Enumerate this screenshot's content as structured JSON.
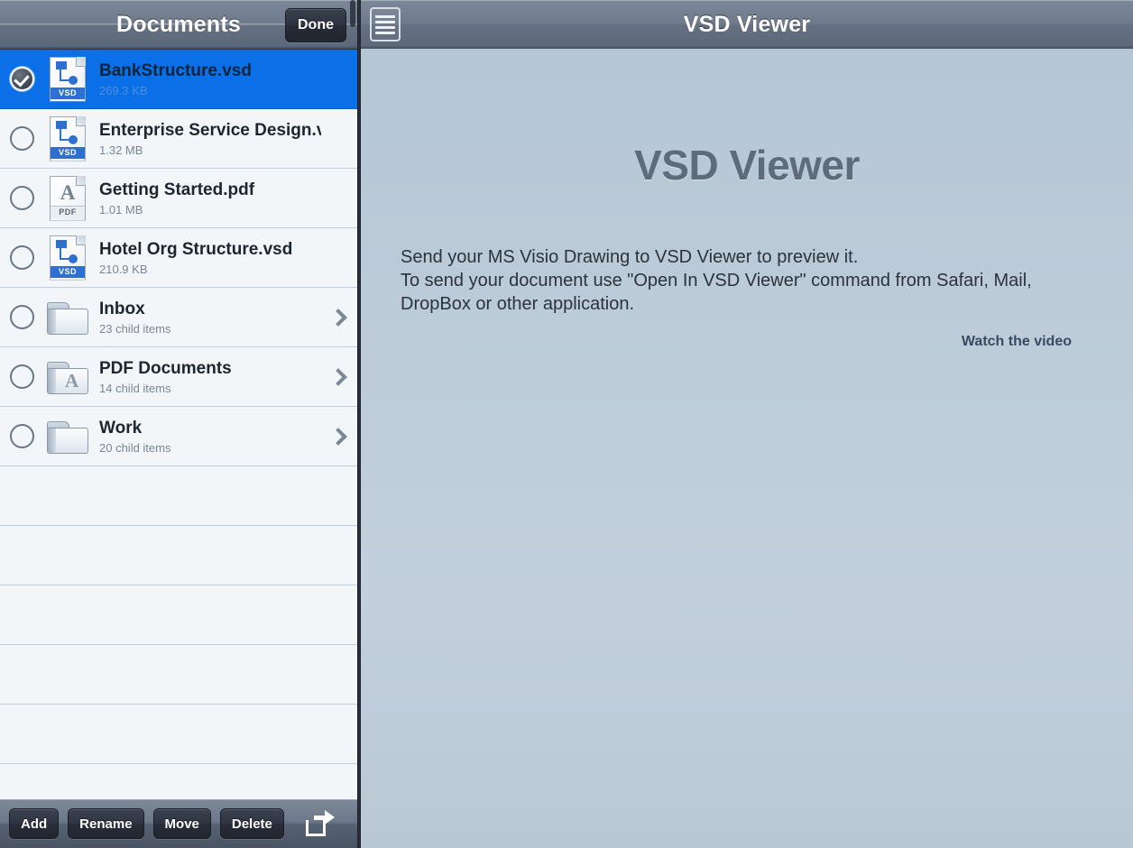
{
  "left_panel": {
    "navbar": {
      "title": "Documents",
      "done_label": "Done"
    },
    "files": [
      {
        "name": "BankStructure.vsd",
        "detail": "269.3 KB",
        "kind": "vsd",
        "selected": true,
        "badge": "VSD",
        "has_chevron": false
      },
      {
        "name": "Enterprise Service Design.vs",
        "detail": "1.32 MB",
        "kind": "vsd",
        "selected": false,
        "badge": "VSD",
        "has_chevron": false
      },
      {
        "name": "Getting Started.pdf",
        "detail": "1.01 MB",
        "kind": "pdf",
        "selected": false,
        "badge": "PDF",
        "has_chevron": false
      },
      {
        "name": "Hotel Org Structure.vsd",
        "detail": "210.9 KB",
        "kind": "vsd",
        "selected": false,
        "badge": "VSD",
        "has_chevron": false
      },
      {
        "name": "Inbox",
        "detail": "23 child items",
        "kind": "folder",
        "selected": false,
        "badge": "",
        "has_chevron": true
      },
      {
        "name": "PDF Documents",
        "detail": "14 child items",
        "kind": "folder-pdf",
        "selected": false,
        "badge": "",
        "has_chevron": true
      },
      {
        "name": "Work",
        "detail": "20 child items",
        "kind": "folder",
        "selected": false,
        "badge": "",
        "has_chevron": true
      }
    ],
    "empty_row_count": 6,
    "toolbar": {
      "add_label": "Add",
      "rename_label": "Rename",
      "move_label": "Move",
      "delete_label": "Delete",
      "share_icon": "share-icon"
    }
  },
  "right_panel": {
    "navbar": {
      "title": "VSD Viewer",
      "menu_icon": "list-menu-icon"
    },
    "heading": "VSD Viewer",
    "instructions": {
      "line1": "Send your MS Visio Drawing to VSD Viewer to preview it.",
      "line2": "To send your document use \"Open In VSD Viewer\" command from Safari, Mail,",
      "line3": "DropBox or other application."
    },
    "watch_video_label": "Watch the video"
  },
  "colors": {
    "selection_blue": "#0b70e8",
    "navbar_gray": "#6f7b8c",
    "vsd_badge_blue": "#2f6fd0",
    "link_color": "#394a63",
    "canvas_blue": "#bccbd8"
  }
}
